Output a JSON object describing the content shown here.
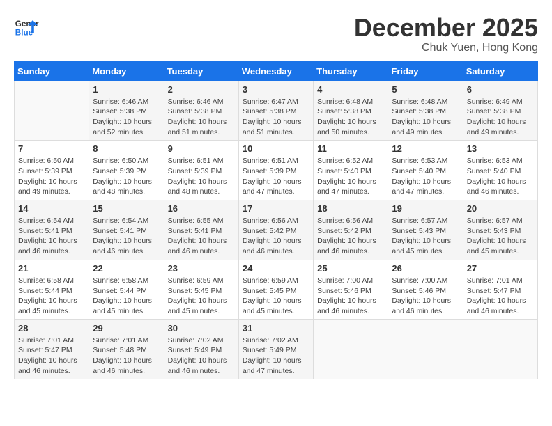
{
  "header": {
    "logo_line1": "General",
    "logo_line2": "Blue",
    "month_year": "December 2025",
    "location": "Chuk Yuen, Hong Kong"
  },
  "weekdays": [
    "Sunday",
    "Monday",
    "Tuesday",
    "Wednesday",
    "Thursday",
    "Friday",
    "Saturday"
  ],
  "weeks": [
    [
      {
        "day": "",
        "info": ""
      },
      {
        "day": "1",
        "info": "Sunrise: 6:46 AM\nSunset: 5:38 PM\nDaylight: 10 hours\nand 52 minutes."
      },
      {
        "day": "2",
        "info": "Sunrise: 6:46 AM\nSunset: 5:38 PM\nDaylight: 10 hours\nand 51 minutes."
      },
      {
        "day": "3",
        "info": "Sunrise: 6:47 AM\nSunset: 5:38 PM\nDaylight: 10 hours\nand 51 minutes."
      },
      {
        "day": "4",
        "info": "Sunrise: 6:48 AM\nSunset: 5:38 PM\nDaylight: 10 hours\nand 50 minutes."
      },
      {
        "day": "5",
        "info": "Sunrise: 6:48 AM\nSunset: 5:38 PM\nDaylight: 10 hours\nand 49 minutes."
      },
      {
        "day": "6",
        "info": "Sunrise: 6:49 AM\nSunset: 5:38 PM\nDaylight: 10 hours\nand 49 minutes."
      }
    ],
    [
      {
        "day": "7",
        "info": "Sunrise: 6:50 AM\nSunset: 5:39 PM\nDaylight: 10 hours\nand 49 minutes."
      },
      {
        "day": "8",
        "info": "Sunrise: 6:50 AM\nSunset: 5:39 PM\nDaylight: 10 hours\nand 48 minutes."
      },
      {
        "day": "9",
        "info": "Sunrise: 6:51 AM\nSunset: 5:39 PM\nDaylight: 10 hours\nand 48 minutes."
      },
      {
        "day": "10",
        "info": "Sunrise: 6:51 AM\nSunset: 5:39 PM\nDaylight: 10 hours\nand 47 minutes."
      },
      {
        "day": "11",
        "info": "Sunrise: 6:52 AM\nSunset: 5:40 PM\nDaylight: 10 hours\nand 47 minutes."
      },
      {
        "day": "12",
        "info": "Sunrise: 6:53 AM\nSunset: 5:40 PM\nDaylight: 10 hours\nand 47 minutes."
      },
      {
        "day": "13",
        "info": "Sunrise: 6:53 AM\nSunset: 5:40 PM\nDaylight: 10 hours\nand 46 minutes."
      }
    ],
    [
      {
        "day": "14",
        "info": "Sunrise: 6:54 AM\nSunset: 5:41 PM\nDaylight: 10 hours\nand 46 minutes."
      },
      {
        "day": "15",
        "info": "Sunrise: 6:54 AM\nSunset: 5:41 PM\nDaylight: 10 hours\nand 46 minutes."
      },
      {
        "day": "16",
        "info": "Sunrise: 6:55 AM\nSunset: 5:41 PM\nDaylight: 10 hours\nand 46 minutes."
      },
      {
        "day": "17",
        "info": "Sunrise: 6:56 AM\nSunset: 5:42 PM\nDaylight: 10 hours\nand 46 minutes."
      },
      {
        "day": "18",
        "info": "Sunrise: 6:56 AM\nSunset: 5:42 PM\nDaylight: 10 hours\nand 46 minutes."
      },
      {
        "day": "19",
        "info": "Sunrise: 6:57 AM\nSunset: 5:43 PM\nDaylight: 10 hours\nand 45 minutes."
      },
      {
        "day": "20",
        "info": "Sunrise: 6:57 AM\nSunset: 5:43 PM\nDaylight: 10 hours\nand 45 minutes."
      }
    ],
    [
      {
        "day": "21",
        "info": "Sunrise: 6:58 AM\nSunset: 5:44 PM\nDaylight: 10 hours\nand 45 minutes."
      },
      {
        "day": "22",
        "info": "Sunrise: 6:58 AM\nSunset: 5:44 PM\nDaylight: 10 hours\nand 45 minutes."
      },
      {
        "day": "23",
        "info": "Sunrise: 6:59 AM\nSunset: 5:45 PM\nDaylight: 10 hours\nand 45 minutes."
      },
      {
        "day": "24",
        "info": "Sunrise: 6:59 AM\nSunset: 5:45 PM\nDaylight: 10 hours\nand 45 minutes."
      },
      {
        "day": "25",
        "info": "Sunrise: 7:00 AM\nSunset: 5:46 PM\nDaylight: 10 hours\nand 46 minutes."
      },
      {
        "day": "26",
        "info": "Sunrise: 7:00 AM\nSunset: 5:46 PM\nDaylight: 10 hours\nand 46 minutes."
      },
      {
        "day": "27",
        "info": "Sunrise: 7:01 AM\nSunset: 5:47 PM\nDaylight: 10 hours\nand 46 minutes."
      }
    ],
    [
      {
        "day": "28",
        "info": "Sunrise: 7:01 AM\nSunset: 5:47 PM\nDaylight: 10 hours\nand 46 minutes."
      },
      {
        "day": "29",
        "info": "Sunrise: 7:01 AM\nSunset: 5:48 PM\nDaylight: 10 hours\nand 46 minutes."
      },
      {
        "day": "30",
        "info": "Sunrise: 7:02 AM\nSunset: 5:49 PM\nDaylight: 10 hours\nand 46 minutes."
      },
      {
        "day": "31",
        "info": "Sunrise: 7:02 AM\nSunset: 5:49 PM\nDaylight: 10 hours\nand 47 minutes."
      },
      {
        "day": "",
        "info": ""
      },
      {
        "day": "",
        "info": ""
      },
      {
        "day": "",
        "info": ""
      }
    ]
  ]
}
